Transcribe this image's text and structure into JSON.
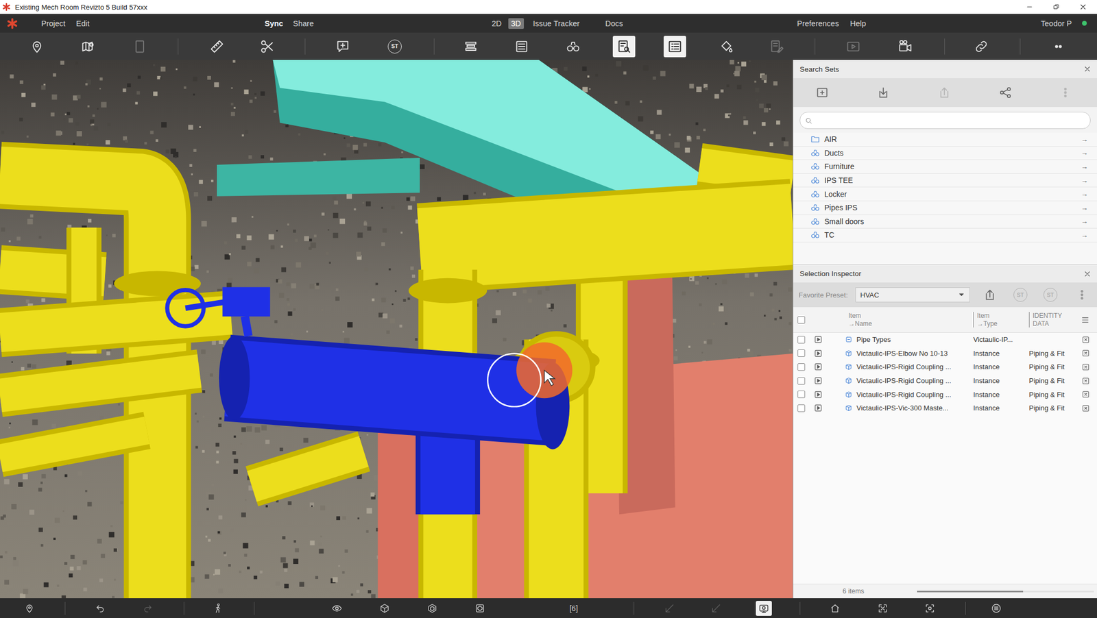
{
  "window": {
    "title": "Existing Mech Room Revizto 5 Build 57xxx"
  },
  "menu": {
    "left": [
      "Project",
      "Edit"
    ],
    "sync": [
      "Sync",
      "Share"
    ],
    "modes": [
      {
        "label": "2D",
        "selected": false
      },
      {
        "label": "3D",
        "selected": true
      }
    ],
    "nav": [
      "Issue Tracker",
      "Docs"
    ],
    "right": [
      "Preferences",
      "Help"
    ],
    "user": "Teodor P"
  },
  "toolbar": [
    {
      "kind": "button",
      "active": false,
      "disabled": false
    },
    {
      "kind": "button",
      "active": false,
      "disabled": false
    },
    {
      "kind": "button",
      "active": false,
      "disabled": true
    },
    {
      "kind": "separator"
    },
    {
      "kind": "button",
      "active": false,
      "disabled": false
    },
    {
      "kind": "button",
      "active": false,
      "disabled": false
    },
    {
      "kind": "separator"
    },
    {
      "kind": "button",
      "active": false,
      "disabled": false
    },
    {
      "kind": "badge",
      "label": "ST",
      "active": false,
      "disabled": false
    },
    {
      "kind": "separator"
    },
    {
      "kind": "button",
      "active": false,
      "disabled": false
    },
    {
      "kind": "button",
      "active": false,
      "disabled": false
    },
    {
      "kind": "button",
      "active": false,
      "disabled": false
    },
    {
      "kind": "button",
      "active": true,
      "disabled": false
    },
    {
      "kind": "button",
      "active": true,
      "disabled": false
    },
    {
      "kind": "button",
      "active": false,
      "disabled": false
    },
    {
      "kind": "button",
      "active": false,
      "disabled": true
    },
    {
      "kind": "separator"
    },
    {
      "kind": "button",
      "active": false,
      "disabled": true
    },
    {
      "kind": "button",
      "active": false,
      "disabled": false
    },
    {
      "kind": "separator"
    },
    {
      "kind": "button",
      "active": false,
      "disabled": false
    },
    {
      "kind": "separator"
    },
    {
      "kind": "button",
      "active": false,
      "disabled": false
    }
  ],
  "search_sets": {
    "title": "Search Sets",
    "tools": [
      {
        "disabled": false
      },
      {
        "disabled": false
      },
      {
        "disabled": true
      },
      {
        "disabled": false
      },
      {
        "disabled": true
      }
    ],
    "items": [
      {
        "label": "AIR",
        "kind": "folder",
        "arrow": "→"
      },
      {
        "label": "Ducts",
        "kind": "set",
        "arrow": "→"
      },
      {
        "label": "Furniture",
        "kind": "set",
        "arrow": "→"
      },
      {
        "label": "IPS TEE",
        "kind": "set",
        "arrow": "→"
      },
      {
        "label": "Locker",
        "kind": "set",
        "arrow": "→"
      },
      {
        "label": "Pipes IPS",
        "kind": "set",
        "arrow": "→"
      },
      {
        "label": "Small doors",
        "kind": "set",
        "arrow": "→"
      },
      {
        "label": "TC",
        "kind": "set",
        "arrow": "→"
      }
    ]
  },
  "inspector": {
    "title": "Selection Inspector",
    "preset_label": "Favorite Preset:",
    "preset": "HVAC",
    "tools": [
      {
        "kind": "button",
        "disabled": false
      },
      {
        "kind": "badge",
        "label": "ST",
        "disabled": true
      },
      {
        "kind": "badge",
        "label": "ST",
        "disabled": true
      },
      {
        "kind": "button",
        "disabled": true
      }
    ],
    "header_checked": false,
    "columns": [
      {
        "line1": "Item",
        "line2": "→Name"
      },
      {
        "line1": "Item",
        "line2": "→Type"
      },
      {
        "line1": "IDENTITY",
        "line2": "DATA"
      }
    ],
    "rows": [
      {
        "name": "Pipe Types",
        "type": "Victaulic-IP...",
        "kind": "type",
        "checked": false
      },
      {
        "name": "Victaulic-IPS-Elbow No 10-13",
        "type": "Instance",
        "identity": "Piping & Fit",
        "kind": "instance",
        "checked": false
      },
      {
        "name": "Victaulic-IPS-Rigid Coupling ...",
        "type": "Instance",
        "identity": "Piping & Fit",
        "kind": "instance",
        "checked": false
      },
      {
        "name": "Victaulic-IPS-Rigid Coupling ...",
        "type": "Instance",
        "identity": "Piping & Fit",
        "kind": "instance",
        "checked": false
      },
      {
        "name": "Victaulic-IPS-Rigid Coupling ...",
        "type": "Instance",
        "identity": "Piping & Fit",
        "kind": "instance",
        "checked": false
      },
      {
        "name": "Victaulic-IPS-Vic-300 Maste...",
        "type": "Instance",
        "identity": "Piping & Fit",
        "kind": "instance",
        "checked": false
      }
    ],
    "footer": "6 items",
    "scroll": {
      "level": 0.6
    }
  },
  "bottom_bar": [
    {
      "kind": "button",
      "active": false,
      "disabled": false
    },
    {
      "kind": "separator"
    },
    {
      "kind": "button",
      "active": false,
      "disabled": false
    },
    {
      "kind": "button",
      "active": false,
      "disabled": true
    },
    {
      "kind": "separator"
    },
    {
      "kind": "button",
      "active": false,
      "disabled": false
    },
    {
      "kind": "separator"
    },
    {
      "kind": "button",
      "active": false,
      "disabled": false
    },
    {
      "kind": "button",
      "active": false,
      "disabled": false
    },
    {
      "kind": "button",
      "active": false,
      "disabled": false
    },
    {
      "kind": "button",
      "active": false,
      "disabled": false
    },
    {
      "kind": "text",
      "label": "[6]",
      "active": false,
      "disabled": false
    },
    {
      "kind": "separator"
    },
    {
      "kind": "button",
      "active": false,
      "disabled": true
    },
    {
      "kind": "button",
      "active": false,
      "disabled": true
    },
    {
      "kind": "button",
      "active": true,
      "disabled": false
    },
    {
      "kind": "separator"
    },
    {
      "kind": "button",
      "active": false,
      "disabled": false
    },
    {
      "kind": "button",
      "active": false,
      "disabled": false
    },
    {
      "kind": "button",
      "active": false,
      "disabled": false
    },
    {
      "kind": "separator"
    },
    {
      "kind": "button",
      "active": false,
      "disabled": false
    }
  ]
}
